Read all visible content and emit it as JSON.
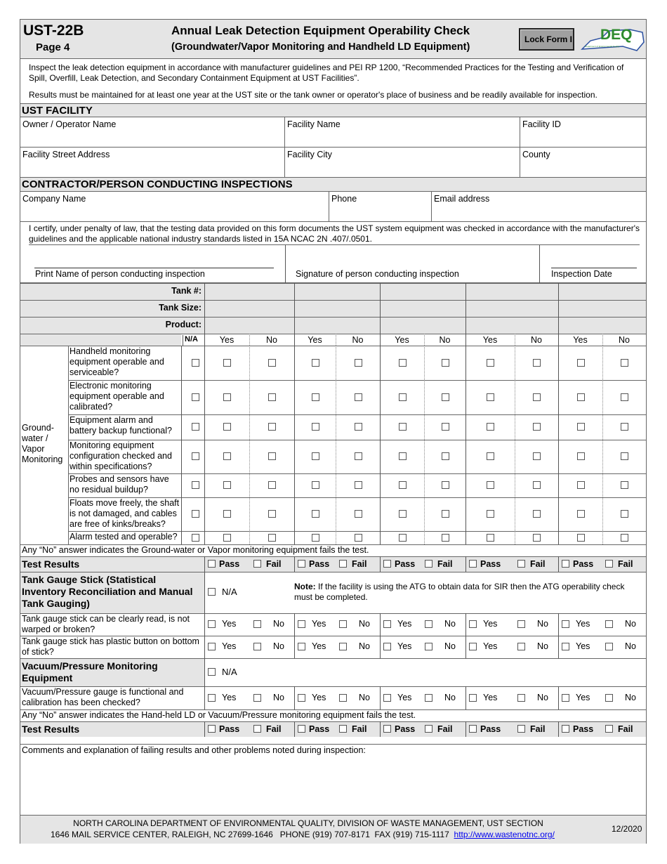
{
  "header": {
    "form_code": "UST-22B",
    "page": "Page 4",
    "title": "Annual Leak Detection Equipment Operability Check",
    "subtitle": "(Groundwater/Vapor Monitoring and Handheld LD Equipment)",
    "lock_button": "Lock Form I",
    "logo_text": "DEQ",
    "logo_subtext": "Department of Environmental Quality"
  },
  "intro": {
    "line1": "Inspect the leak detection equipment in accordance with manufacturer guidelines and PEI RP 1200, “Recommended Practices for the Testing and Verification of Spill, Overfill, Leak Detection, and Secondary Containment Equipment at UST Facilities”.",
    "line2": "Results must be maintained for at least one year at the UST site or the tank owner or operator's place of business and be readily available for inspection."
  },
  "facility": {
    "section_title": "UST FACILITY",
    "owner_label": "Owner / Operator Name",
    "facility_name_label": "Facility Name",
    "facility_id_label": "Facility ID",
    "street_label": "Facility Street Address",
    "city_label": "Facility City",
    "county_label": "County"
  },
  "contractor": {
    "section_title": "CONTRACTOR/PERSON CONDUCTING INSPECTIONS",
    "company_label": "Company Name",
    "phone_label": "Phone",
    "email_label": "Email address",
    "certify": "I certify, under penalty of law, that the testing data provided on this form documents the UST system equipment was checked in accordance with the manufacturer's guidelines and the applicable national industry standards listed in 15A NCAC 2N .407/.0501.",
    "print_name_label": "Print Name of person conducting inspection",
    "signature_label": "Signature of person conducting inspection",
    "date_label": "Inspection Date"
  },
  "tank_table": {
    "tank_num_label": "Tank #:",
    "tank_size_label": "Tank Size:",
    "product_label": "Product:",
    "na_label": "N/A",
    "yes_label": "Yes",
    "no_label": "No",
    "tank_count": 5,
    "group_label": "Ground-water / Vapor Monitoring",
    "questions": [
      "Handheld monitoring equipment operable and serviceable?",
      "Electronic monitoring equipment operable and calibrated?",
      "Equipment alarm and battery backup functional?",
      "Monitoring equipment configuration checked and within specifications?",
      "Probes and sensors have no residual buildup?",
      "Floats move freely, the shaft is not damaged, and cables are free of kinks/breaks?",
      "Alarm tested and operable?"
    ],
    "gw_note": "Any “No” answer indicates the Ground-water or Vapor monitoring equipment fails the test.",
    "test_results_label": "Test Results",
    "pass_label": "Pass",
    "fail_label": "Fail"
  },
  "gauge_stick": {
    "title": "Tank Gauge Stick (Statistical Inventory Reconciliation and Manual Tank Gauging)",
    "na_label": "N/A",
    "note_bold": "Note:",
    "note_text": " If the facility is using the ATG to obtain data for SIR then the ATG operability check must be completed.",
    "q1": "Tank gauge stick can be clearly read, is not warped or broken?",
    "q2": "Tank gauge stick has plastic button on bottom of stick?"
  },
  "vacuum": {
    "title": "Vacuum/Pressure Monitoring Equipment",
    "na_label": "N/A",
    "q1": "Vacuum/Pressure gauge is functional and calibration has been checked?",
    "note": "Any “No” answer indicates the Hand-held LD or Vacuum/Pressure monitoring equipment fails the test.",
    "test_results_label": "Test Results"
  },
  "comments": {
    "label": "Comments and explanation of failing results and other problems noted during inspection:"
  },
  "footer": {
    "line1": "NORTH CAROLINA DEPARTMENT OF ENVIRONMENTAL QUALITY, DIVISION OF WASTE MANAGEMENT, UST SECTION",
    "line2": "1646 MAIL SERVICE CENTER, RALEIGH, NC 27699-1646   PHONE (919) 707-8171  FAX (919) 715-1117",
    "link": "http://www.wastenotnc.org/",
    "revision": "12/2020"
  },
  "colors": {
    "section_gray": "#e5e5e5",
    "logo_green": "#2e8b2e",
    "logo_blue": "#2a4fa0",
    "lock_button_bg": "#a0a0a0"
  }
}
